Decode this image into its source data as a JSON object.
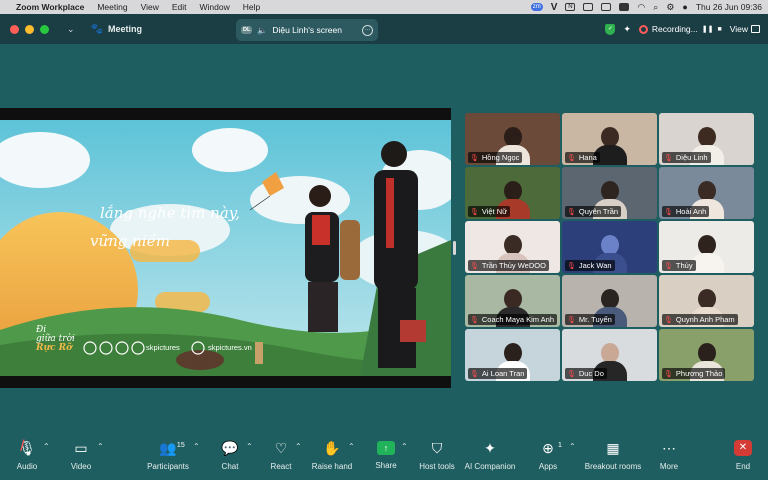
{
  "menubar": {
    "app": "Zoom Workplace",
    "items": [
      "Meeting",
      "View",
      "Edit",
      "Window",
      "Help"
    ],
    "clock": "Thu 26 Jun  09:36"
  },
  "titlebar": {
    "meeting_label": "Meeting",
    "share_tab": {
      "initials": "DL",
      "title": "Diệu Linh's screen"
    },
    "recording_label": "Recording...",
    "view_label": "View",
    "colors": {
      "background": "#1b3e44",
      "shield": "#2fb150",
      "recording": "#ff5b5b"
    }
  },
  "shared_screen": {
    "caption_line1": "lắng nghe tim này,",
    "caption_line2": "vững niềm",
    "logo_line1": "Đi",
    "logo_line2": "giữa trời",
    "logo_line3": "Rực Rỡ",
    "social_handle": "skpictures",
    "website": "skpictures.vn"
  },
  "participants": [
    {
      "name": "Hồng Ngọc",
      "bg": "#6b4a3a",
      "head": "#2b1d18",
      "body": "#ede4dc"
    },
    {
      "name": "Hana",
      "bg": "#c9b7a3",
      "head": "#3a2a22",
      "body": "#1d1d1d"
    },
    {
      "name": "Diệu Linh",
      "bg": "#d9d4cf",
      "head": "#3d2b22",
      "body": "#f2efe9"
    },
    {
      "name": "Việt Nữ",
      "bg": "#4d6a3a",
      "head": "#2a1f18",
      "body": "#a83a2a"
    },
    {
      "name": "Quyên Trần",
      "bg": "#5b6670",
      "head": "#2e2420",
      "body": "#d8d0c6"
    },
    {
      "name": "Hoài Anh",
      "bg": "#7a8a9a",
      "head": "#3a2c24",
      "body": "#efe7de"
    },
    {
      "name": "Trần Thủy WeDOO",
      "bg": "#efe7e4",
      "head": "#3a2b25",
      "body": "#d9c3bd"
    },
    {
      "name": "Jack Wan",
      "bg": "#2c3f7a",
      "head": "#6c82c8",
      "body": "#3b4f8e"
    },
    {
      "name": "Thủy",
      "bg": "#ecebe8",
      "head": "#2e231d",
      "body": "#f7f4ef"
    },
    {
      "name": "Coach Maya Kim Anh",
      "bg": "#a8b8a2",
      "head": "#3a2a23",
      "body": "#2a2a2a"
    },
    {
      "name": "Mr. Tuyến",
      "bg": "#b9b3ad",
      "head": "#2a2420",
      "body": "#4a5a7a"
    },
    {
      "name": "Quynh Anh Pham",
      "bg": "#d9cfc3",
      "head": "#3a2c24",
      "body": "#e8dccf"
    },
    {
      "name": "Ai Loan Tran",
      "bg": "#c6d4db",
      "head": "#2a211c",
      "body": "#ffffff"
    },
    {
      "name": "Duc Do",
      "bg": "#d8dcdf",
      "head": "#c9a896",
      "body": "#262626"
    },
    {
      "name": "Phương Thảo",
      "bg": "#8aa06a",
      "head": "#2a211c",
      "body": "#eae5da"
    }
  ],
  "toolbar": {
    "audio": "Audio",
    "video": "Video",
    "participants": "Participants",
    "participants_count": "15",
    "chat": "Chat",
    "react": "React",
    "raise_hand": "Raise hand",
    "share": "Share",
    "host_tools": "Host tools",
    "ai_companion": "AI Companion",
    "apps": "Apps",
    "apps_count": "1",
    "breakout_rooms": "Breakout rooms",
    "more": "More",
    "end": "End",
    "colors": {
      "share": "#21b35a",
      "end": "#d43b34",
      "background": "#1f5e60"
    }
  }
}
